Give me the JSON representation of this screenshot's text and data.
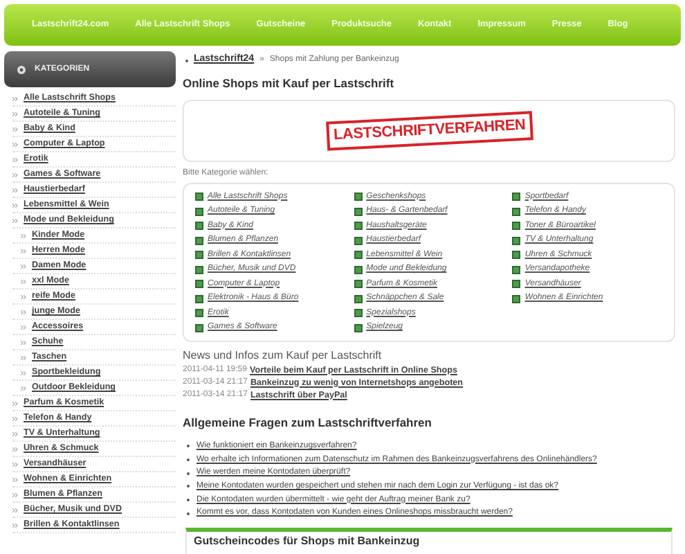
{
  "nav": [
    "Lastschrift24.com",
    "Alle Lastschrift Shops",
    "Gutscheine",
    "Produktsuche",
    "Kontakt",
    "Impressum",
    "Presse",
    "Blog"
  ],
  "sidebar": {
    "title": "KATEGORIEN",
    "items": [
      {
        "label": "Alle Lastschrift Shops"
      },
      {
        "label": "Autoteile & Tuning"
      },
      {
        "label": "Baby & Kind"
      },
      {
        "label": "Computer & Laptop"
      },
      {
        "label": "Erotik"
      },
      {
        "label": "Games & Software"
      },
      {
        "label": "Haustierbedarf"
      },
      {
        "label": "Lebensmittel & Wein"
      },
      {
        "label": "Mode und Bekleidung",
        "children": [
          {
            "label": "Kinder Mode"
          },
          {
            "label": "Herren Mode"
          },
          {
            "label": "Damen Mode"
          },
          {
            "label": "xxl Mode"
          },
          {
            "label": "reife Mode"
          },
          {
            "label": "junge Mode"
          },
          {
            "label": "Accessoires"
          },
          {
            "label": "Schuhe"
          },
          {
            "label": "Taschen"
          },
          {
            "label": "Sportbekleidung"
          },
          {
            "label": "Outdoor Bekleidung"
          }
        ]
      },
      {
        "label": "Parfum & Kosmetik"
      },
      {
        "label": "Telefon & Handy"
      },
      {
        "label": "TV & Unterhaltung"
      },
      {
        "label": "Uhren & Schmuck"
      },
      {
        "label": "Versandhäuser"
      },
      {
        "label": "Wohnen & Einrichten"
      },
      {
        "label": "Blumen & Pflanzen"
      },
      {
        "label": "Bücher, Musik und DVD"
      },
      {
        "label": "Brillen & Kontaktlinsen"
      }
    ]
  },
  "breadcrumb": {
    "root": "Lastschrift24",
    "separator": "»",
    "current": "Shops mit Zahlung per Bankeinzug"
  },
  "title": "Online Shops mit Kauf per Lastschrift",
  "logo_text": "LASTSCHRIFTVERFAHREN",
  "prompt": "Bitte Kategorie wählen:",
  "category_columns": [
    [
      "Alle Lastschrift Shops",
      "Autoteile & Tuning",
      "Baby & Kind",
      "Blumen & Pflanzen",
      "Brillen & Kontaktlinsen",
      "Bücher, Musik und DVD",
      "Computer & Laptop",
      "Elektronik - Haus & Büro",
      "Erotik",
      "Games & Software"
    ],
    [
      "Geschenkshops",
      "Haus- & Gartenbedarf",
      "Haushaltsgeräte",
      "Haustierbedarf",
      "Lebensmittel & Wein",
      "Mode und Bekleidung",
      "Parfum & Kosmetik",
      "Schnäppchen & Sale",
      "Spezialshops",
      "Spielzeug"
    ],
    [
      "Sportbedarf",
      "Telefon & Handy",
      "Toner & Büroartikel",
      "TV & Unterhaltung",
      "Uhren & Schmuck",
      "Versandapotheke",
      "Versandhäuser",
      "Wohnen & Einrichten"
    ]
  ],
  "news": {
    "title": "News und Infos zum Kauf per Lastschrift",
    "items": [
      {
        "time": "2011-04-11 19:59",
        "title": "Vorteile beim Kauf per Lastschrift in Online Shops"
      },
      {
        "time": "2011-03-14 21:17",
        "title": "Bankeinzug zu wenig von Internetshops angeboten"
      },
      {
        "time": "2011-03-14 21:17",
        "title": "Lastschrift über PayPal"
      }
    ]
  },
  "faq": {
    "title": "Allgemeine Fragen zum Lastschriftverfahren",
    "items": [
      "Wie funktioniert ein Bankeinzugsverfahren?",
      "Wo erhalte ich Informationen zum Datenschutz im Rahmen des Bankeinzugsverfahrens des Onlinehändlers?",
      "Wie werden meine Kontodaten überprüft?",
      "Meine Kontodaten wurden gespeichert und stehen mir nach dem Login zur Verfügung - ist das ok?",
      "Die Kontodaten wurden übermittelt - wie geht der Auftrag meiner Bank zu?",
      "Kommt es vor, dass Kontodaten von Kunden eines Onlineshops missbraucht werden?"
    ]
  },
  "coupons": {
    "title": "Gutscheincodes für Shops mit Bankeinzug"
  }
}
